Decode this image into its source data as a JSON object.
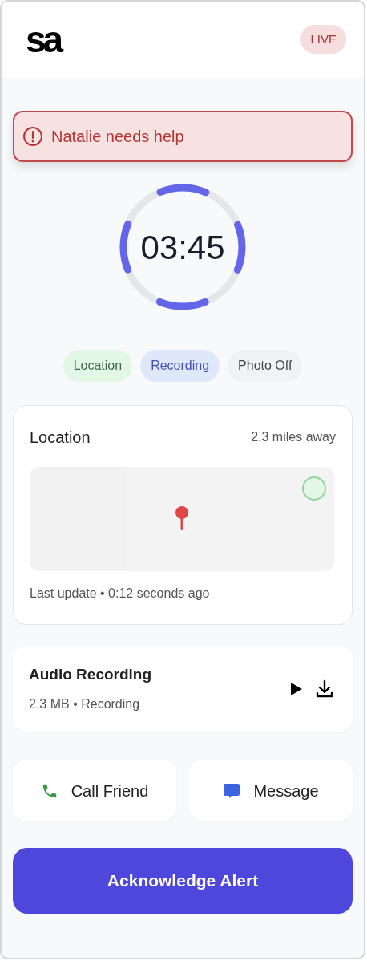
{
  "header": {
    "logo": "sa",
    "badge": "LIVE"
  },
  "alert": {
    "message": "Natalie needs help"
  },
  "timer": {
    "time": "03:45"
  },
  "statuses": [
    {
      "label": "Location",
      "kind": "location"
    },
    {
      "label": "Recording",
      "kind": "recording"
    },
    {
      "label": "Photo Off",
      "kind": "off"
    }
  ],
  "location": {
    "title": "Location",
    "distance": "2.3 miles away",
    "updated": "Last update • 0:12 seconds ago"
  },
  "audio": {
    "title": "Audio Recording",
    "meta": "2.3 MB • Recording"
  },
  "actions": [
    {
      "label": "Call Friend",
      "kind": "call"
    },
    {
      "label": "Message",
      "kind": "message"
    }
  ],
  "primary_button": "Acknowledge Alert"
}
